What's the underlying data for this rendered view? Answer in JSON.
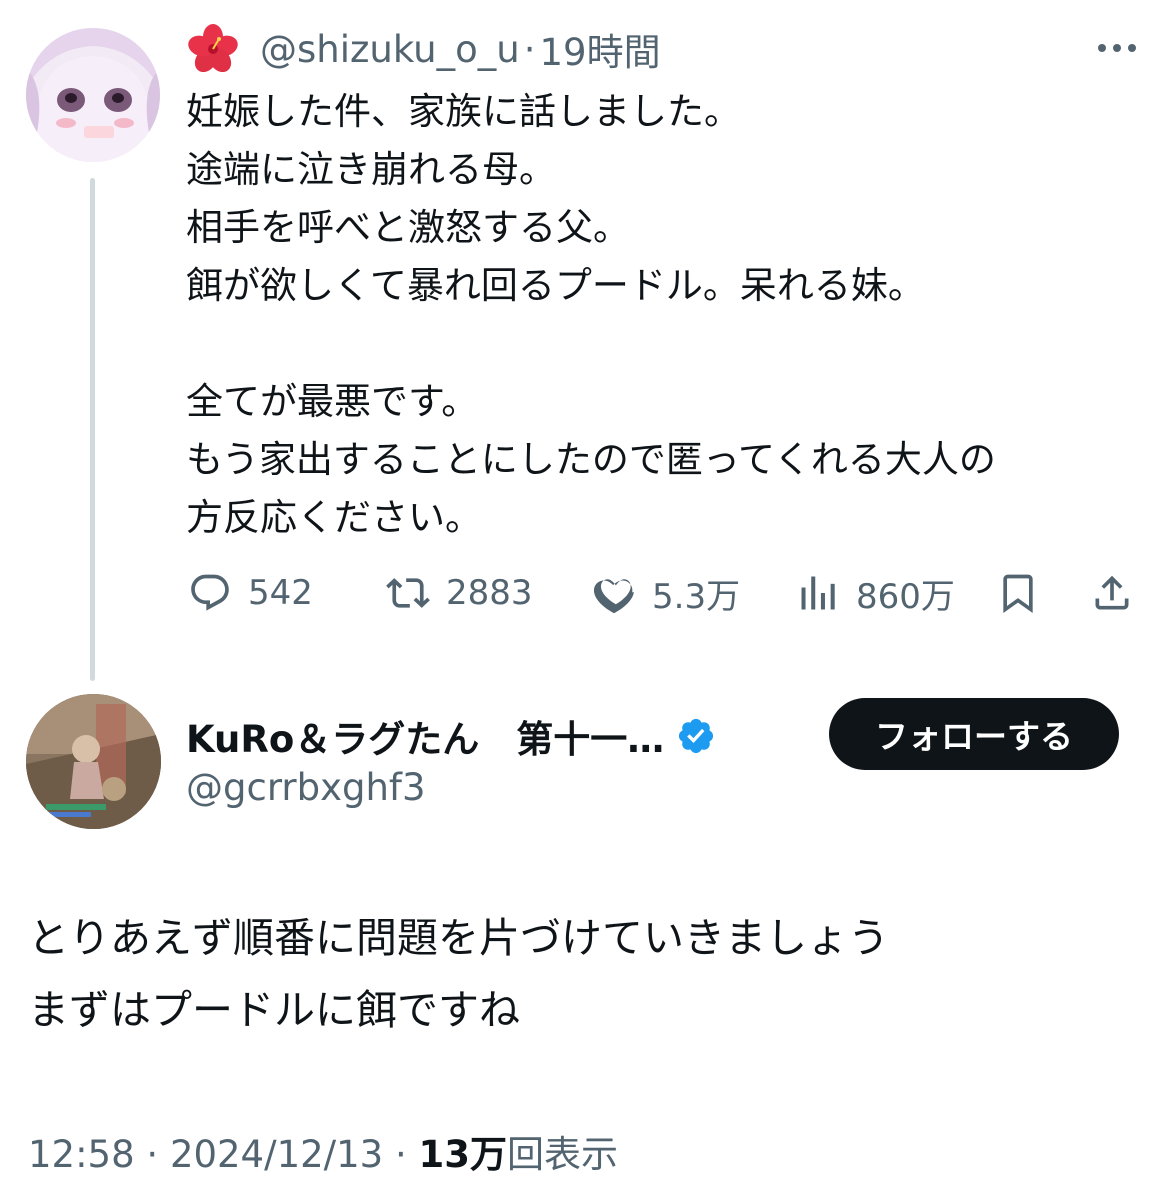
{
  "parent_tweet": {
    "handle": "@shizuku_o_u",
    "separator": "·",
    "time_ago": "19時間",
    "lines": [
      "妊娠した件、家族に話しました。",
      "途端に泣き崩れる母。",
      "相手を呼べと激怒する父。",
      "餌が欲しくて暴れ回るプードル。呆れる妹。",
      "",
      "全てが最悪です。",
      "もう家出することにしたので匿ってくれる大人の",
      "方反応ください。"
    ],
    "stats": {
      "replies": "542",
      "reposts": "2883",
      "likes": "5.3万",
      "views": "860万"
    },
    "icons": [
      "hibiscus-emoji",
      "more-icon",
      "reply-icon",
      "repost-icon",
      "like-icon",
      "views-icon",
      "bookmark-icon",
      "share-icon"
    ]
  },
  "reply_tweet": {
    "display_name": "KuRo＆ラグたん　第十一…",
    "handle": "@gcrrbxghf3",
    "follow_label": "フォローする",
    "lines": [
      "とりあえず順番に問題を片づけていきましょう",
      "まずはプードルに餌ですね"
    ],
    "footer": {
      "time": "12:58",
      "sep1": " · ",
      "date": "2024/12/13",
      "sep2": " · ",
      "views_count": "13万",
      "views_label": "回表示"
    },
    "icons": [
      "verified-badge-icon"
    ]
  },
  "colors": {
    "text": "#0f1419",
    "secondary": "#536471",
    "thread_line": "#cfd9de",
    "verified": "#1d9bf0",
    "follow_button": "#0f1419"
  }
}
